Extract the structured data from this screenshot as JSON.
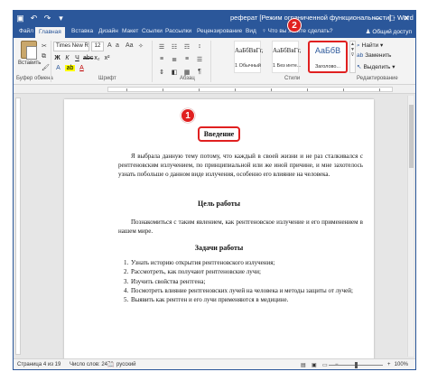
{
  "window": {
    "title": "реферат [Режим ограниченной функциональности] - Word",
    "controls": [
      "—",
      "□",
      "✕"
    ]
  },
  "quick_access": [
    "save-icon",
    "undo-icon",
    "redo-icon",
    "customize-icon"
  ],
  "quick_access_glyphs": [
    "▣",
    "↶",
    "↷",
    "▾"
  ],
  "tabs": [
    {
      "label": "Файл"
    },
    {
      "label": "Главная"
    },
    {
      "label": "Вставка"
    },
    {
      "label": "Дизайн"
    },
    {
      "label": "Макет"
    },
    {
      "label": "Ссылки"
    },
    {
      "label": "Рассылки"
    },
    {
      "label": "Рецензирование"
    },
    {
      "label": "Вид"
    },
    {
      "label": "♀ Что вы хотите сделать?"
    }
  ],
  "active_tab": "Главная",
  "share_label": "Общий доступ",
  "ribbon": {
    "clipboard": {
      "paste_label": "Вставить",
      "group_label": "Буфер обмена"
    },
    "font": {
      "name": "Times New R",
      "size": "12",
      "group_label": "Шрифт"
    },
    "paragraph": {
      "group_label": "Абзац"
    },
    "styles": {
      "group_label": "Стили",
      "cards": [
        {
          "preview": "АаБбВвГг,",
          "name": "1 Обычный"
        },
        {
          "preview": "АаБбВвГг,",
          "name": "1 Без инте..."
        },
        {
          "preview": "АаБбВ",
          "name": "Заголово..."
        }
      ]
    },
    "editing": {
      "group_label": "Редактирование",
      "items": [
        {
          "icon": "find-icon",
          "glyph": "⌕",
          "label": "Найти ▾"
        },
        {
          "icon": "replace-icon",
          "glyph": "ab",
          "label": "Заменить"
        },
        {
          "icon": "select-icon",
          "glyph": "↖",
          "label": "Выделить ▾"
        }
      ]
    }
  },
  "document": {
    "intro_heading": "Введение",
    "intro_paragraph": "Я выбрала данную тему потому, что каждый в своей жизни и не раз сталкивался с рентгеновским излучением, по принципиальной или же иной причине, и мне захотелось узнать побольше о данном виде излучения, особенно его влияние на человека.",
    "goal_heading": "Цель работы",
    "goal_paragraph": "Познакомиться с таким явлением, как рентгеновское излучение и его применением в нашем мире.",
    "tasks_heading": "Задачи работы",
    "tasks": [
      {
        "num": "1.",
        "text": "Узнать историю открытия рентгеновского излучения;"
      },
      {
        "num": "2.",
        "text": "Рассмотреть, как получают рентгеновские лучи;"
      },
      {
        "num": "3.",
        "text": "Изучить свойства рентгена;"
      },
      {
        "num": "4.",
        "text": "Посмотреть влияние рентгеновских лучей на человека и методы защиты от лучей;"
      },
      {
        "num": "5.",
        "text": "Выявить как рентген и его лучи применяются в медицине."
      }
    ]
  },
  "markers": [
    "1",
    "2"
  ],
  "status": {
    "page": "Страница 4 из 19",
    "words": "Число слов: 2470",
    "language": "русский",
    "zoom": "100%"
  },
  "colors": {
    "accent": "#2b579a",
    "highlight": "#e02020"
  }
}
